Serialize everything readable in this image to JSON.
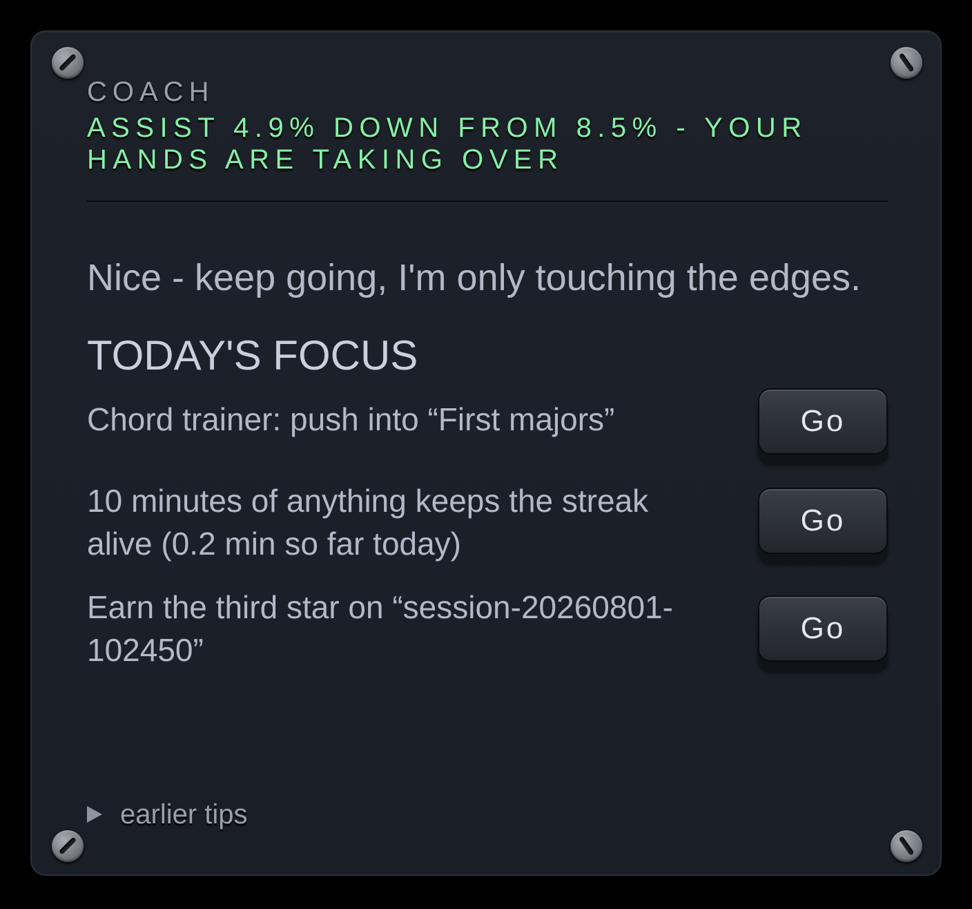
{
  "coach": {
    "label": "COACH",
    "assist_status": "ASSIST 4.9% DOWN FROM 8.5% - YOUR HANDS ARE TAKING OVER",
    "message": "Nice - keep going, I'm only touching the edges."
  },
  "focus": {
    "heading": "TODAY'S FOCUS",
    "items": [
      {
        "text": "Chord trainer: push into “First majors”",
        "button": "Go"
      },
      {
        "text": "10 minutes of anything keeps the streak alive (0.2 min so far today)",
        "button": "Go"
      },
      {
        "text": "Earn the third star on “session-20260801-102450”",
        "button": "Go"
      }
    ]
  },
  "earlier_tips": {
    "label": "earlier tips",
    "icon": "disclosure-triangle-right-icon"
  },
  "colors": {
    "accent_green": "#86f0a6",
    "panel_bg": "#1b1f27",
    "text": "#b3b9c7"
  }
}
